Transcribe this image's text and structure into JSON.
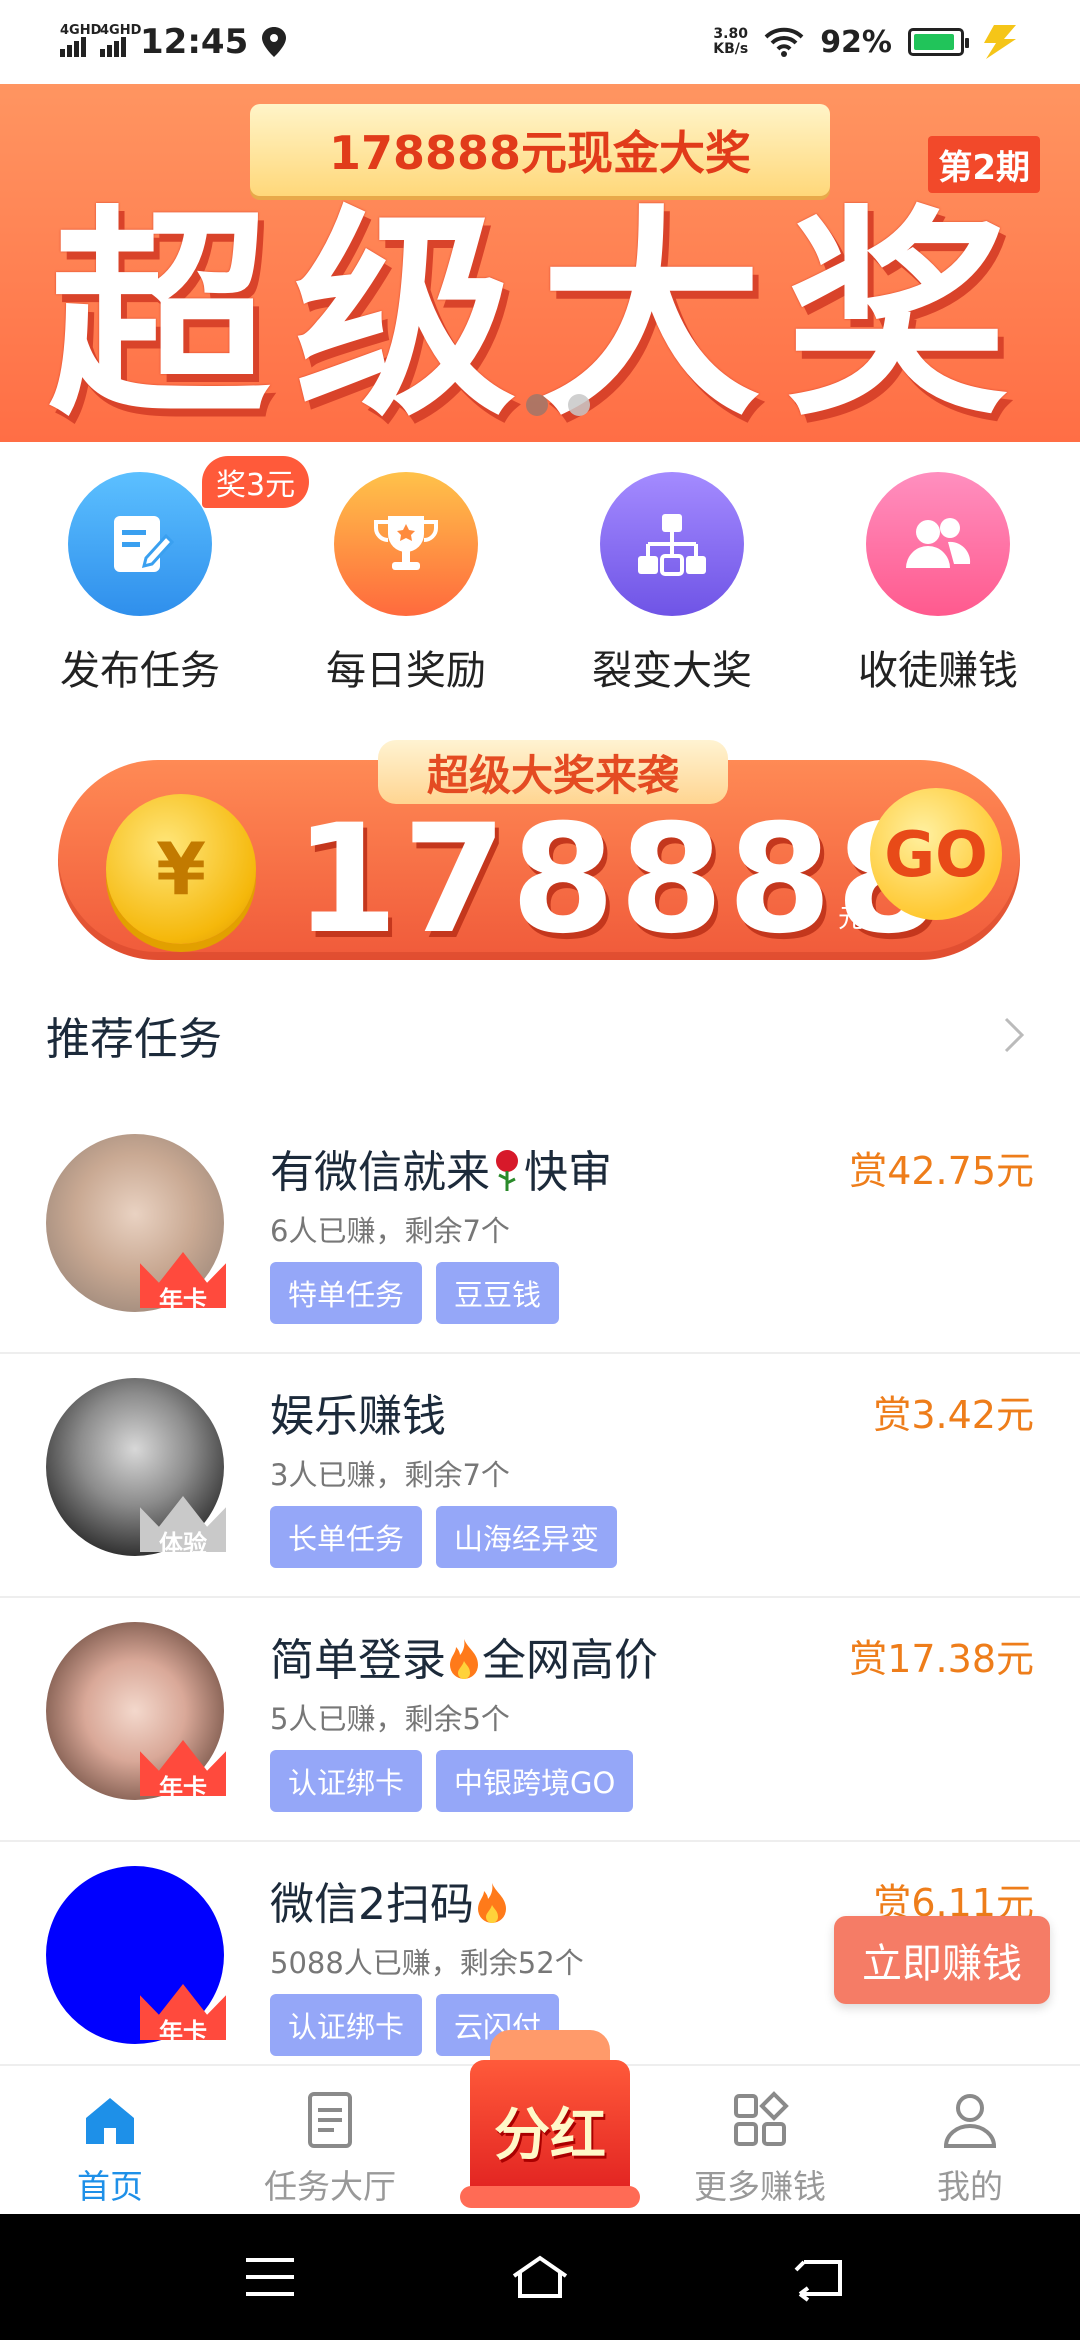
{
  "status_bar": {
    "net1": "4GHD",
    "net2": "4GHD",
    "time": "12:45",
    "speed_value": "3.80",
    "speed_unit": "KB/s",
    "battery": "92%",
    "battery_level": 0.92
  },
  "banner": {
    "ribbon_text": "178888元现金大奖",
    "period": "第2期",
    "title": "超级大奖",
    "slide_count": 2,
    "active_slide": 2
  },
  "quick_actions": [
    {
      "label": "发布任务",
      "icon": "edit-note-icon",
      "color": "#3aa0f0",
      "badge": "奖3元"
    },
    {
      "label": "每日奖励",
      "icon": "trophy-icon",
      "color": "#ff8a3d"
    },
    {
      "label": "裂变大奖",
      "icon": "hierarchy-icon",
      "color": "#8a6cf0"
    },
    {
      "label": "收徒赚钱",
      "icon": "users-icon",
      "color": "#ff6aa0"
    }
  ],
  "promo": {
    "tag": "超级大奖来袭",
    "coin_symbol": "¥",
    "amount": "178888",
    "unit": "元",
    "go": "GO"
  },
  "section": {
    "title": "推荐任务"
  },
  "tasks": [
    {
      "name_pre": "有微信就来",
      "emoji": "rose-icon",
      "name_post": "快审",
      "meta": "6人已赚，剩余7个",
      "tags": [
        "特单任务",
        "豆豆钱"
      ],
      "reward": "赏42.75元",
      "crown": "年卡"
    },
    {
      "name_pre": "娱乐赚钱",
      "emoji": "",
      "name_post": "",
      "meta": "3人已赚，剩余7个",
      "tags": [
        "长单任务",
        "山海经异变"
      ],
      "reward": "赏3.42元",
      "crown": "体验"
    },
    {
      "name_pre": "简单登录",
      "emoji": "fire-icon",
      "name_post": "全网高价",
      "meta": "5人已赚，剩余5个",
      "tags": [
        "认证绑卡",
        "中银跨境GO"
      ],
      "reward": "赏17.38元",
      "crown": "年卡"
    },
    {
      "name_pre": "微信2扫码",
      "emoji": "fire-icon",
      "name_post": "",
      "meta": "5088人已赚，剩余52个",
      "tags": [
        "认证绑卡",
        "云闪付"
      ],
      "reward": "赏6.11元",
      "crown": "年卡"
    }
  ],
  "cta": "立即赚钱",
  "bottom_nav": [
    {
      "label": "首页",
      "icon": "home-icon",
      "active": true
    },
    {
      "label": "任务大厅",
      "icon": "document-icon",
      "active": false
    },
    {
      "label": "分红",
      "icon": "red-envelope-icon",
      "active": false
    },
    {
      "label": "更多赚钱",
      "icon": "grid-icon",
      "active": false
    },
    {
      "label": "我的",
      "icon": "person-icon",
      "active": false
    }
  ],
  "colors": {
    "accent_blue": "#1e90e8",
    "reward_orange": "#ee7d1a",
    "tag_blue": "#95a7f8",
    "banner_orange": "#ff6e45"
  }
}
